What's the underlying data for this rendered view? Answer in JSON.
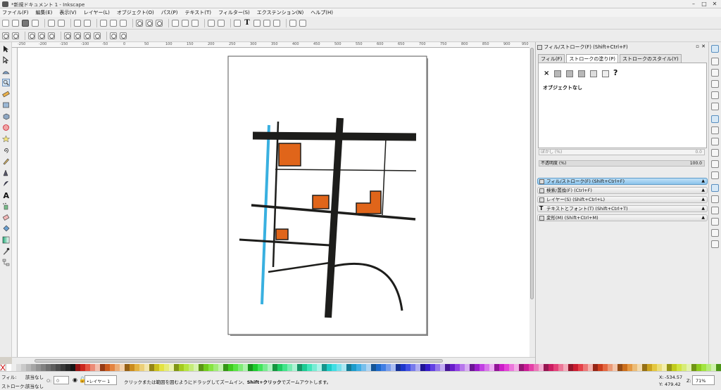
{
  "window": {
    "title": "*新規ドキュメント 1 - Inkscape"
  },
  "menu": [
    "ファイル(F)",
    "編集(E)",
    "表示(V)",
    "レイヤー(L)",
    "オブジェクト(O)",
    "パス(P)",
    "テキスト(T)",
    "フィルター(S)",
    "エクステンション(N)",
    "ヘルプ(H)"
  ],
  "ruler": {
    "labels": [
      "-250",
      "-200",
      "-150",
      "-100",
      "-50",
      "0",
      "50",
      "100",
      "150",
      "200",
      "250",
      "300",
      "350",
      "400",
      "450",
      "500",
      "550",
      "600",
      "650",
      "700",
      "750",
      "800",
      "850",
      "900",
      "950"
    ]
  },
  "dock": {
    "header": "フィル/ストローク(F) (Shift+Ctrl+F)",
    "tabs": [
      "フィル(F)",
      "ストロークの塗り(P)",
      "ストロークのスタイル(Y)"
    ],
    "active_tab": 1,
    "no_object": "オブジェクトなし",
    "help_glyph": "?",
    "close_glyph": "×",
    "blur_label": "ぼかし (%)",
    "blur_value": "0.0",
    "opacity_label": "不透明度 (%)",
    "opacity_value": "100.0",
    "items": [
      "フィル/ストローク(F) (Shift+Ctrl+F)",
      "検索/置換(F) (Ctrl+F)",
      "レイヤー(S) (Shift+Ctrl+L)",
      "テキストとフォント(T) (Shift+Ctrl+T)",
      "変形(M) (Shift+Ctrl+M)"
    ]
  },
  "status": {
    "fill_label": "フィル:",
    "stroke_label": "ストローク:",
    "fill_value": "該当なし",
    "stroke_value": "該当なし",
    "opacity_small": "O:",
    "opacity_small_value": "0",
    "layer": "•レイヤー 1",
    "message_1": "クリックまたは範囲を囲むようにドラッグしてズームイン、",
    "message_bold": "Shift+クリック",
    "message_2": "でズームアウトします。",
    "x_label": "X:",
    "y_label": "Y:",
    "x_value": "-534.57",
    "y_value": "479.42",
    "z_label": "Z:",
    "zoom": "71%"
  },
  "colors": {
    "accent_blue": "#39b0e0",
    "orange": "#e0651a",
    "road": "#1d1d1b",
    "active_item": "#8cc4ec"
  }
}
